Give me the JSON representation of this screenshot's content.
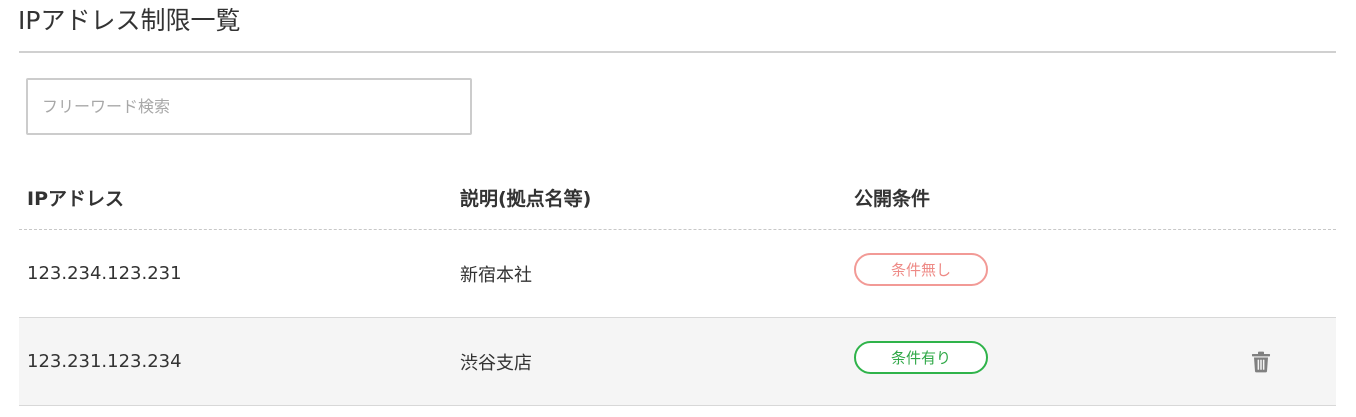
{
  "page": {
    "title": "IPアドレス制限一覧"
  },
  "search": {
    "placeholder": "フリーワード検索",
    "value": ""
  },
  "table": {
    "headers": {
      "ip": "IPアドレス",
      "description": "説明(拠点名等)",
      "condition": "公開条件"
    },
    "rows": [
      {
        "ip": "123.234.123.231",
        "description": "新宿本社",
        "condition": "条件無し",
        "condition_color": "#ee8a86",
        "has_delete": false
      },
      {
        "ip": "123.231.123.234",
        "description": "渋谷支店",
        "condition": "条件有り",
        "condition_color": "#2fa847",
        "has_delete": true,
        "delete_icon": "trash-icon"
      }
    ]
  }
}
